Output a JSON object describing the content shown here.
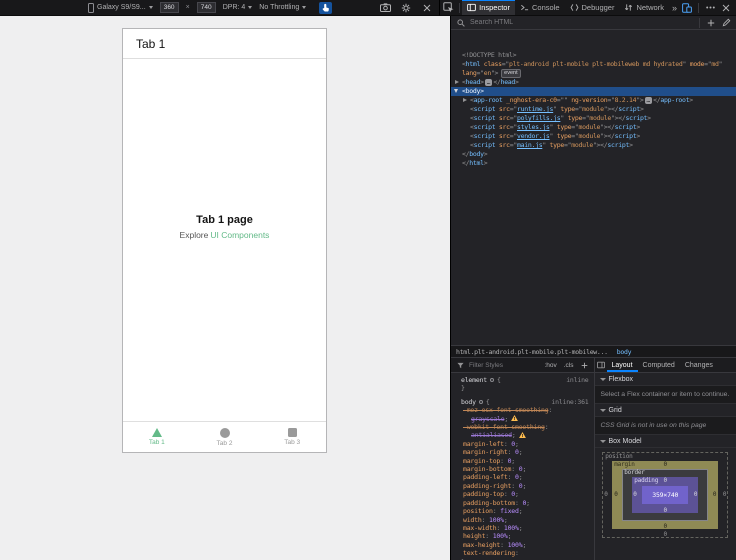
{
  "colors": {
    "accent": "#63ba88",
    "devtools_blue": "#0a84ff",
    "selection": "#204e8a"
  },
  "rdm": {
    "device_label": "Galaxy S9/S9...",
    "width_value": "360",
    "x_sep": "×",
    "height_value": "740",
    "dpr_label": "DPR: 4",
    "throttling_label": "No Throttling"
  },
  "toolbox": {
    "tabs": [
      {
        "label": "Inspector",
        "active": true
      },
      {
        "label": "Console",
        "active": false
      },
      {
        "label": "Debugger",
        "active": false
      },
      {
        "label": "Network",
        "active": false
      }
    ],
    "overflow_glyph": "»"
  },
  "inspector": {
    "search_placeholder": "Search HTML",
    "lines": [
      {
        "indent": 0,
        "arrow": "",
        "selected": false,
        "tokens": [
          [
            "doctype",
            "<!DOCTYPE html>"
          ]
        ]
      },
      {
        "indent": 0,
        "arrow": "",
        "selected": false,
        "tokens": [
          [
            "punct",
            "<"
          ],
          [
            "tag",
            "html"
          ],
          [
            "attr",
            " class"
          ],
          [
            "punct",
            "=\""
          ],
          [
            "val",
            "plt-android plt-mobile plt-mobileweb md hydrated"
          ],
          [
            "punct",
            "\""
          ],
          [
            "attr",
            " mode"
          ],
          [
            "punct",
            "=\""
          ],
          [
            "val",
            "md"
          ],
          [
            "punct",
            "\""
          ]
        ]
      },
      {
        "indent": 0,
        "arrow": "",
        "selected": false,
        "tokens": [
          [
            "attr",
            "lang"
          ],
          [
            "punct",
            "=\""
          ],
          [
            "val",
            "en"
          ],
          [
            "punct",
            "\">"
          ],
          [
            "badge",
            "event"
          ]
        ]
      },
      {
        "indent": 0,
        "arrow": "right",
        "selected": false,
        "tokens": [
          [
            "punct",
            "<"
          ],
          [
            "tag",
            "head"
          ],
          [
            "punct",
            ">"
          ],
          [
            "ellipsis",
            "…"
          ],
          [
            "punct",
            "</"
          ],
          [
            "tag",
            "head"
          ],
          [
            "punct",
            ">"
          ]
        ]
      },
      {
        "indent": 0,
        "arrow": "down",
        "selected": true,
        "tokens": [
          [
            "punct",
            "<"
          ],
          [
            "tag",
            "body"
          ],
          [
            "punct",
            ">"
          ]
        ]
      },
      {
        "indent": 1,
        "arrow": "right",
        "selected": false,
        "tokens": [
          [
            "punct",
            "<"
          ],
          [
            "tag",
            "app-root"
          ],
          [
            "attr",
            " _nghost-era-c0"
          ],
          [
            "punct",
            "=\"\""
          ],
          [
            "attr",
            " ng-version"
          ],
          [
            "punct",
            "=\""
          ],
          [
            "val",
            "8.2.14"
          ],
          [
            "punct",
            "\">"
          ],
          [
            "ellipsis",
            "…"
          ],
          [
            "punct",
            "</"
          ],
          [
            "tag",
            "app-root"
          ],
          [
            "punct",
            ">"
          ]
        ]
      },
      {
        "indent": 1,
        "arrow": "",
        "selected": false,
        "tokens": [
          [
            "punct",
            "<"
          ],
          [
            "tag",
            "script"
          ],
          [
            "attr",
            " src"
          ],
          [
            "punct",
            "=\""
          ],
          [
            "link",
            "runtime.js"
          ],
          [
            "punct",
            "\""
          ],
          [
            "attr",
            " type"
          ],
          [
            "punct",
            "=\""
          ],
          [
            "val",
            "module"
          ],
          [
            "punct",
            "\">"
          ],
          [
            "punct",
            "</"
          ],
          [
            "tag",
            "script"
          ],
          [
            "punct",
            ">"
          ]
        ]
      },
      {
        "indent": 1,
        "arrow": "",
        "selected": false,
        "tokens": [
          [
            "punct",
            "<"
          ],
          [
            "tag",
            "script"
          ],
          [
            "attr",
            " src"
          ],
          [
            "punct",
            "=\""
          ],
          [
            "link",
            "polyfills.js"
          ],
          [
            "punct",
            "\""
          ],
          [
            "attr",
            " type"
          ],
          [
            "punct",
            "=\""
          ],
          [
            "val",
            "module"
          ],
          [
            "punct",
            "\">"
          ],
          [
            "punct",
            "</"
          ],
          [
            "tag",
            "script"
          ],
          [
            "punct",
            ">"
          ]
        ]
      },
      {
        "indent": 1,
        "arrow": "",
        "selected": false,
        "tokens": [
          [
            "punct",
            "<"
          ],
          [
            "tag",
            "script"
          ],
          [
            "attr",
            " src"
          ],
          [
            "punct",
            "=\""
          ],
          [
            "link",
            "styles.js"
          ],
          [
            "punct",
            "\""
          ],
          [
            "attr",
            " type"
          ],
          [
            "punct",
            "=\""
          ],
          [
            "val",
            "module"
          ],
          [
            "punct",
            "\">"
          ],
          [
            "punct",
            "</"
          ],
          [
            "tag",
            "script"
          ],
          [
            "punct",
            ">"
          ]
        ]
      },
      {
        "indent": 1,
        "arrow": "",
        "selected": false,
        "tokens": [
          [
            "punct",
            "<"
          ],
          [
            "tag",
            "script"
          ],
          [
            "attr",
            " src"
          ],
          [
            "punct",
            "=\""
          ],
          [
            "link",
            "vendor.js"
          ],
          [
            "punct",
            "\""
          ],
          [
            "attr",
            " type"
          ],
          [
            "punct",
            "=\""
          ],
          [
            "val",
            "module"
          ],
          [
            "punct",
            "\">"
          ],
          [
            "punct",
            "</"
          ],
          [
            "tag",
            "script"
          ],
          [
            "punct",
            ">"
          ]
        ]
      },
      {
        "indent": 1,
        "arrow": "",
        "selected": false,
        "tokens": [
          [
            "punct",
            "<"
          ],
          [
            "tag",
            "script"
          ],
          [
            "attr",
            " src"
          ],
          [
            "punct",
            "=\""
          ],
          [
            "link",
            "main.js"
          ],
          [
            "punct",
            "\""
          ],
          [
            "attr",
            " type"
          ],
          [
            "punct",
            "=\""
          ],
          [
            "val",
            "module"
          ],
          [
            "punct",
            "\">"
          ],
          [
            "punct",
            "</"
          ],
          [
            "tag",
            "script"
          ],
          [
            "punct",
            ">"
          ]
        ]
      },
      {
        "indent": 0,
        "arrow": "",
        "selected": false,
        "tokens": [
          [
            "punct",
            "</"
          ],
          [
            "tag",
            "body"
          ],
          [
            "punct",
            ">"
          ]
        ]
      },
      {
        "indent": 0,
        "arrow": "",
        "selected": false,
        "tokens": [
          [
            "punct",
            "</"
          ],
          [
            "tag",
            "html"
          ],
          [
            "punct",
            ">"
          ]
        ]
      }
    ],
    "breadcrumbs": [
      {
        "label": "html.plt-android.plt-mobile.plt-mobilew...",
        "selected": false
      },
      {
        "label": "body",
        "selected": true
      }
    ]
  },
  "rules": {
    "filter_placeholder": "Filter Styles",
    "pseudo_label": ":hov",
    "class_label": ".cls",
    "colon": ": ",
    "semicolon": ";",
    "open_brace": "{",
    "close_brace": "}",
    "rules": [
      {
        "selector": "element",
        "location": "inline",
        "properties": []
      },
      {
        "selector": "body",
        "location": "inline:361",
        "properties": [
          {
            "name": "-moz-osx-font-smoothing",
            "value": "grayscale",
            "invalid": true
          },
          {
            "name": "-webkit-font-smoothing",
            "value": "antialiased",
            "invalid": true
          },
          {
            "name": "margin-left",
            "value": "0"
          },
          {
            "name": "margin-right",
            "value": "0"
          },
          {
            "name": "margin-top",
            "value": "0"
          },
          {
            "name": "margin-bottom",
            "value": "0"
          },
          {
            "name": "padding-left",
            "value": "0"
          },
          {
            "name": "padding-right",
            "value": "0"
          },
          {
            "name": "padding-top",
            "value": "0"
          },
          {
            "name": "padding-bottom",
            "value": "0"
          },
          {
            "name": "position",
            "value": "fixed"
          },
          {
            "name": "width",
            "value": "100%"
          },
          {
            "name": "max-width",
            "value": "100%"
          },
          {
            "name": "height",
            "value": "100%"
          },
          {
            "name": "max-height",
            "value": "100%"
          },
          {
            "name": "text-rendering",
            "value": ""
          }
        ]
      }
    ]
  },
  "layout": {
    "tabs": [
      {
        "label": "Layout",
        "active": true
      },
      {
        "label": "Computed",
        "active": false
      },
      {
        "label": "Changes",
        "active": false
      }
    ],
    "flexbox": {
      "title": "Flexbox",
      "message": "Select a Flex container or item to continue."
    },
    "grid": {
      "title": "Grid",
      "message": "CSS Grid is not in use on this page"
    },
    "boxmodel": {
      "title": "Box Model"
    },
    "box_model": {
      "position_label": "position",
      "margin_label": "margin",
      "border_label": "border",
      "padding_label": "padding",
      "content_size": "359×740",
      "position": {
        "left": "0",
        "right": "0",
        "bottom": "0"
      },
      "margin": {
        "top": "0",
        "right": "0",
        "bottom": "0",
        "left": "0"
      },
      "padding": {
        "top": "0",
        "right": "0",
        "bottom": "0",
        "left": "0"
      }
    }
  },
  "phone": {
    "header_title": "Tab 1",
    "content": {
      "title": "Tab 1 page",
      "subtitle_prefix": "Explore",
      "subtitle_link": "UI Components"
    },
    "tabs": [
      {
        "label": "Tab 1",
        "icon": "triangle",
        "active": true
      },
      {
        "label": "Tab 2",
        "icon": "ellipse",
        "active": false
      },
      {
        "label": "Tab 3",
        "icon": "square",
        "active": false
      }
    ]
  }
}
